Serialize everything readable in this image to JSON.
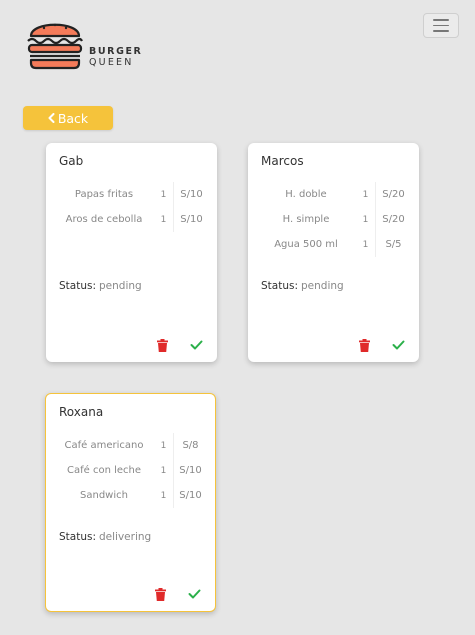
{
  "brand": {
    "line1": "BURGER",
    "line2": "QUEEN"
  },
  "nav": {
    "back_label": "Back"
  },
  "labels": {
    "status": "Status:"
  },
  "colors": {
    "accent": "#f5c33b",
    "delete": "#e02a2a",
    "confirm": "#2bb04a"
  },
  "orders": [
    {
      "client": "Gab",
      "items": [
        {
          "name": "Papas fritas",
          "qty": "1",
          "price": "S/10"
        },
        {
          "name": "Aros de cebolla",
          "qty": "1",
          "price": "S/10"
        }
      ],
      "status": "pending"
    },
    {
      "client": "Marcos",
      "items": [
        {
          "name": "H. doble",
          "qty": "1",
          "price": "S/20"
        },
        {
          "name": "H. simple",
          "qty": "1",
          "price": "S/20"
        },
        {
          "name": "Agua 500 ml",
          "qty": "1",
          "price": "S/5"
        }
      ],
      "status": "pending"
    },
    {
      "client": "Roxana",
      "items": [
        {
          "name": "Café americano",
          "qty": "1",
          "price": "S/8"
        },
        {
          "name": "Café con leche",
          "qty": "1",
          "price": "S/10"
        },
        {
          "name": "Sandwich",
          "qty": "1",
          "price": "S/10"
        }
      ],
      "status": "delivering"
    }
  ]
}
